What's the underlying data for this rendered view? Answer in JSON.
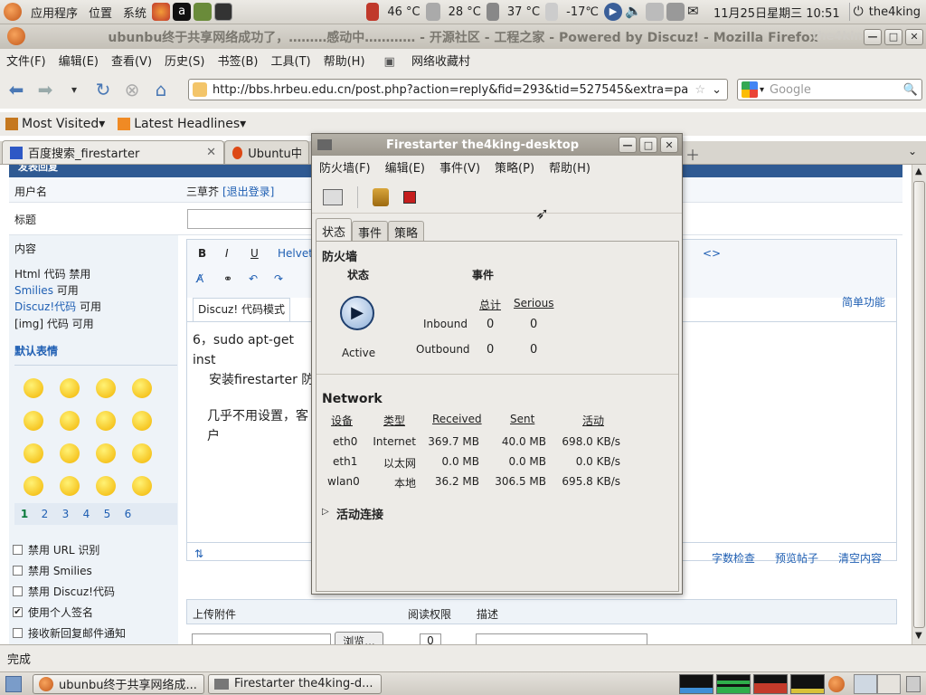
{
  "top_panel": {
    "menus": [
      "应用程序",
      "位置",
      "系统"
    ],
    "temps": [
      "46 °C",
      "28 °C",
      "37 °C",
      "-17℃"
    ],
    "datetime": "11月25日星期三 10:51",
    "user": "the4king"
  },
  "firefox": {
    "title": "ubunbu终于共享网络成功了，………感动中………… - 开源社区 - 工程之家 - Powered by Discuz! - Mozilla Firefox",
    "title_ghost": "the4king",
    "menu": [
      "文件(F)",
      "编辑(E)",
      "查看(V)",
      "历史(S)",
      "书签(B)",
      "工具(T)",
      "帮助(H)",
      "网络收藏村"
    ],
    "url": "http://bbs.hrbeu.edu.cn/post.php?action=reply&fid=293&tid=527545&extra=pa",
    "search_placeholder": "Google",
    "bookmarks": [
      "Most Visited",
      "Latest Headlines"
    ],
    "tabs": [
      "百度搜索_firestarter",
      "Ubuntu中文"
    ],
    "status": "完成"
  },
  "page": {
    "header_text": "发表回复",
    "username_label": "用户名",
    "username_value": "三草芥",
    "logout_text": "[退出登录]",
    "subject_label": "标题",
    "content_label": "内容",
    "html_label": "Html 代码 禁用",
    "smilies_label": "Smilies",
    "smilies_state": "可用",
    "discuz_label": "Discuz!代码",
    "discuz_state": "可用",
    "img_label": "[img] 代码 可用",
    "emoticons_title": "默认表情",
    "emoticon_pages": [
      "1",
      "2",
      "3",
      "4",
      "5",
      "6"
    ],
    "editor_font": "Helvet",
    "editor_mode_tab": "Discuz! 代码模式",
    "simple_func": "简单功能",
    "editor_lines": [
      "6，sudo apt-get inst",
      "安装firestarter 防",
      "几乎不用设置，客户"
    ],
    "checkboxes": [
      {
        "label": "禁用 URL 识别",
        "checked": false
      },
      {
        "label": "禁用 Smilies",
        "checked": false
      },
      {
        "label": "禁用 Discuz!代码",
        "checked": false
      },
      {
        "label": "使用个人签名",
        "checked": true
      },
      {
        "label": "接收新回复邮件通知",
        "checked": false
      }
    ],
    "editor_links": [
      "字数检查",
      "预览帖子",
      "清空内容"
    ],
    "upload_label": "上传附件",
    "read_perm": "阅读权限",
    "describe": "描述",
    "browse_btn": "浏览...",
    "perm_value": "0"
  },
  "firestarter": {
    "title": "Firestarter the4king-desktop",
    "menu": [
      "防火墙(F)",
      "编辑(E)",
      "事件(V)",
      "策略(P)",
      "帮助(H)"
    ],
    "tabs": [
      "状态",
      "事件",
      "策略"
    ],
    "firewall_heading": "防火墙",
    "status_label": "状态",
    "events_label": "事件",
    "total_label": "总计",
    "serious_label": "Serious",
    "active_label": "Active",
    "inbound_label": "Inbound",
    "outbound_label": "Outbound",
    "inbound_total": "0",
    "inbound_serious": "0",
    "outbound_total": "0",
    "outbound_serious": "0",
    "network_heading": "Network",
    "net_headers": [
      "设备",
      "类型",
      "Received",
      "Sent",
      "活动"
    ],
    "net_rows": [
      [
        "eth0",
        "Internet",
        "369.7 MB",
        "40.0 MB",
        "698.0 KB/s"
      ],
      [
        "eth1",
        "以太网",
        "0.0 MB",
        "0.0 MB",
        "0.0 KB/s"
      ],
      [
        "wlan0",
        "本地",
        "36.2 MB",
        "306.5 MB",
        "695.8 KB/s"
      ]
    ],
    "active_connections": "活动连接"
  },
  "taskbar": {
    "tasks": [
      "ubunbu终于共享网络成...",
      "Firestarter the4king-d..."
    ]
  }
}
